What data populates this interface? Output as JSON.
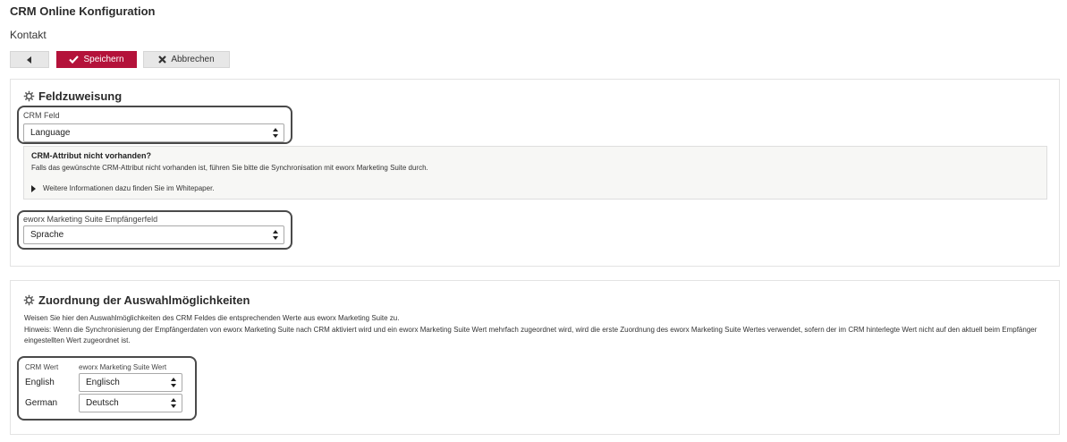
{
  "page": {
    "title": "CRM Online Konfiguration",
    "subtitle": "Kontakt"
  },
  "toolbar": {
    "save_label": "Speichern",
    "cancel_label": "Abbrechen"
  },
  "colors": {
    "primary": "#b4123a",
    "highlight_border": "#4a4a4a"
  },
  "icons": {
    "back": "caret-left-icon",
    "save": "checkmark-icon",
    "cancel": "x-icon",
    "section": "gear-icon",
    "select": "sort-caret-icon",
    "expand": "triangle-right-icon"
  },
  "field_assignment": {
    "heading": "Feldzuweisung",
    "crm_field_label": "CRM Feld",
    "crm_field_value": "Language",
    "info": {
      "title": "CRM-Attribut nicht vorhanden?",
      "text": "Falls das gewünschte CRM-Attribut nicht vorhanden ist, führen Sie bitte die Synchronisation mit eworx Marketing Suite durch.",
      "link": "Weitere Informationen dazu finden Sie im Whitepaper."
    },
    "recipient_field_label": "eworx Marketing Suite Empfängerfeld",
    "recipient_field_value": "Sprache"
  },
  "option_mapping": {
    "heading": "Zuordnung der Auswahlmöglichkeiten",
    "description": "Weisen Sie hier den Auswahlmöglichkeiten des CRM Feldes die entsprechenden Werte aus eworx Marketing Suite zu.",
    "hint": "Hinweis: Wenn die Synchronisierung der Empfängerdaten von eworx Marketing Suite nach CRM aktiviert wird und ein eworx Marketing Suite Wert mehrfach zugeordnet wird, wird die erste Zuordnung des eworx Marketing Suite Wertes verwendet, sofern der im CRM hinterlegte Wert nicht auf den aktuell beim Empfänger eingestellten Wert zugeordnet ist.",
    "col_crm": "CRM Wert",
    "col_ems": "eworx Marketing Suite Wert",
    "rows": [
      {
        "crm": "English",
        "ems": "Englisch"
      },
      {
        "crm": "German",
        "ems": "Deutsch"
      }
    ]
  }
}
